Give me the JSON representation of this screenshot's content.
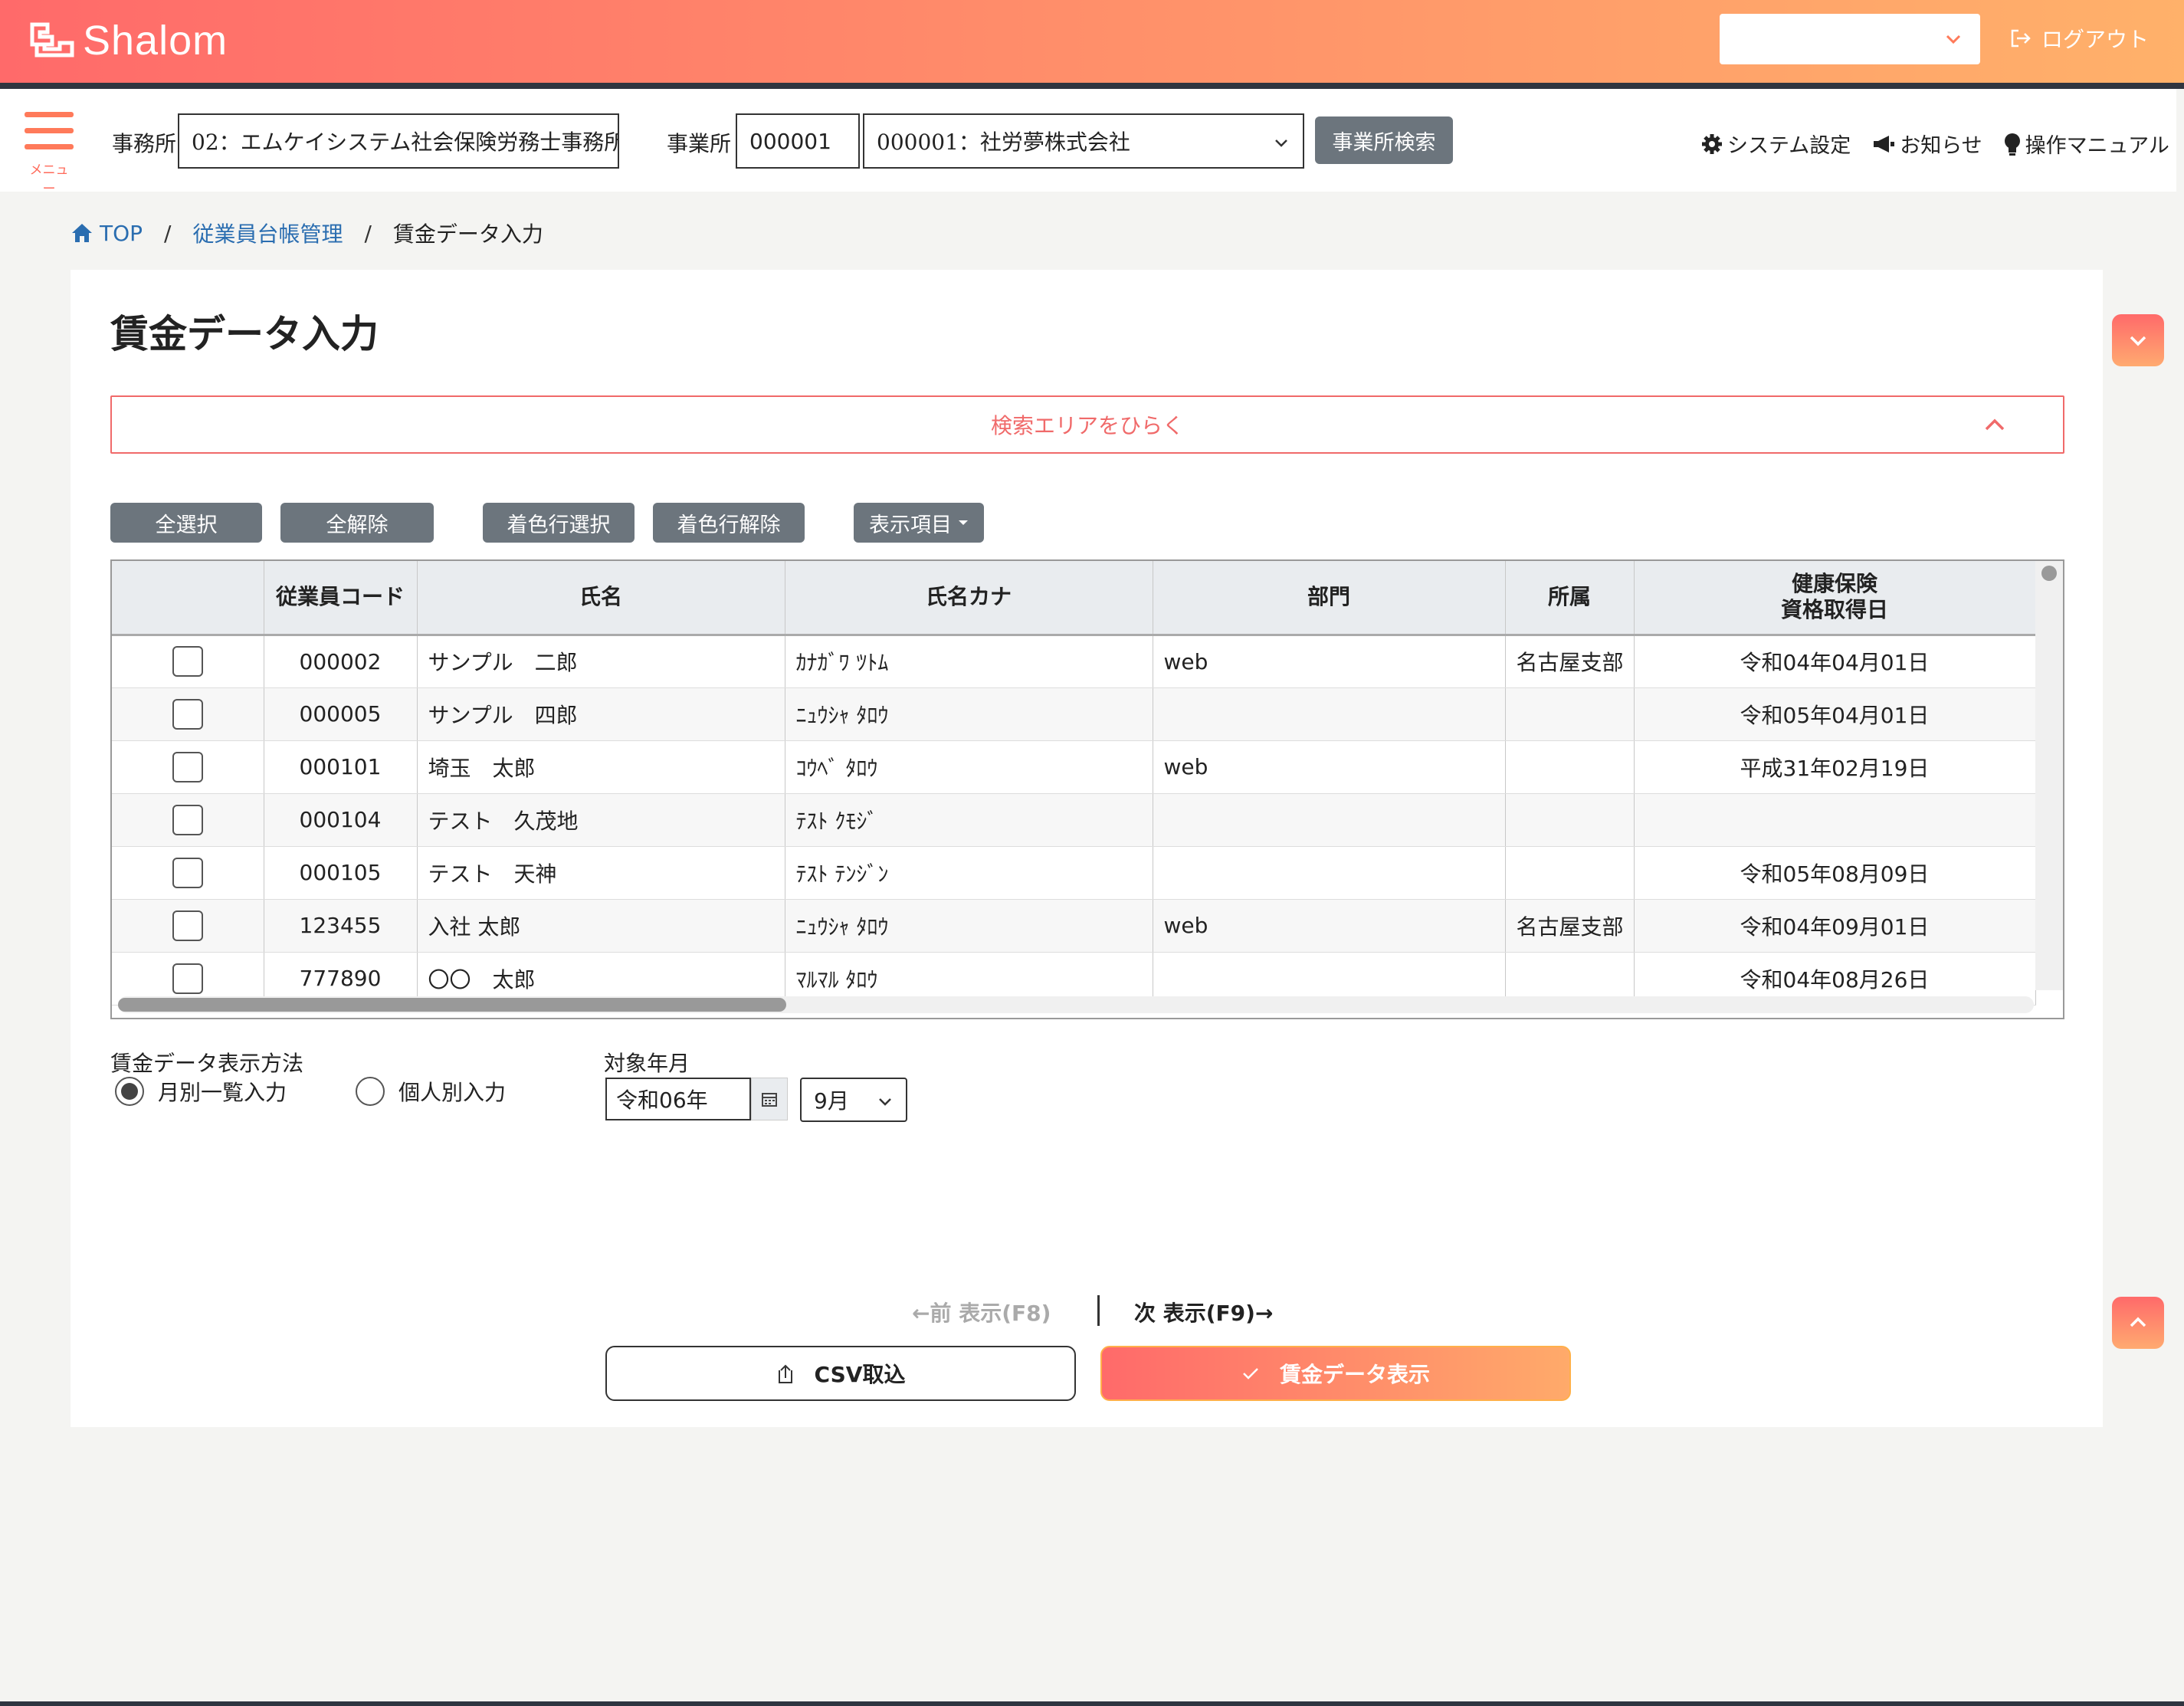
{
  "header": {
    "brand": "Shalom",
    "top_select_value": "",
    "logout_label": "ログアウト",
    "menu_label": "メニュー",
    "office_label": "事務所",
    "office_value": "02：エムケイシステム社会保険労務士事務所",
    "site_label": "事業所",
    "site_code": "000001",
    "site_name": "000001：社労夢株式会社",
    "site_search_button": "事業所検索",
    "links": {
      "system_settings": "システム設定",
      "notices": "お知らせ",
      "manual": "操作マニュアル"
    }
  },
  "breadcrumb": {
    "top": "TOP",
    "sep": "/",
    "level1": "従業員台帳管理",
    "current": "賃金データ入力"
  },
  "page": {
    "title": "賃金データ入力",
    "search_toggle": "検索エリアをひらく"
  },
  "toolbar": {
    "select_all": "全選択",
    "deselect_all": "全解除",
    "select_colored": "着色行選択",
    "deselect_colored": "着色行解除",
    "display_items": "表示項目"
  },
  "table": {
    "headers": [
      "",
      "従業員コード",
      "氏名",
      "氏名カナ",
      "部門",
      "所属",
      "健康保険\n資格取得日"
    ],
    "header_hi_1": "健康保険",
    "header_hi_2": "資格取得日",
    "rows": [
      {
        "code": "000002",
        "name": "サンプル　二郎",
        "kana": "ｶﾅｶﾞﾜ ﾂﾄﾑ",
        "dept": "web",
        "affiliation": "名古屋支部",
        "date": "令和04年04月01日"
      },
      {
        "code": "000005",
        "name": "サンプル　四郎",
        "kana": "ﾆｭｳｼｬ ﾀﾛｳ",
        "dept": "",
        "affiliation": "",
        "date": "令和05年04月01日"
      },
      {
        "code": "000101",
        "name": "埼玉　太郎",
        "kana": "ｺｳﾍﾞ ﾀﾛｳ",
        "dept": "web",
        "affiliation": "",
        "date": "平成31年02月19日"
      },
      {
        "code": "000104",
        "name": "テスト　久茂地",
        "kana": "ﾃｽﾄ ｸﾓｼﾞ",
        "dept": "",
        "affiliation": "",
        "date": ""
      },
      {
        "code": "000105",
        "name": "テスト　天神",
        "kana": "ﾃｽﾄ ﾃﾝｼﾞﾝ",
        "dept": "",
        "affiliation": "",
        "date": "令和05年08月09日"
      },
      {
        "code": "123455",
        "name": "入社 太郎",
        "kana": "ﾆｭｳｼｬ ﾀﾛｳ",
        "dept": "web",
        "affiliation": "名古屋支部",
        "date": "令和04年09月01日"
      },
      {
        "code": "777890",
        "name": "〇〇　太郎",
        "kana": "ﾏﾙﾏﾙ ﾀﾛｳ",
        "dept": "",
        "affiliation": "",
        "date": "令和04年08月26日"
      }
    ]
  },
  "form": {
    "method_label": "賃金データ表示方法",
    "option_monthly": "月別一覧入力",
    "option_individual": "個人別入力",
    "selected_option": "月別一覧入力",
    "target_label": "対象年月",
    "year_value": "令和06年",
    "month_value": "9月"
  },
  "pager": {
    "prev": "←前 表示(F8)",
    "next": "次 表示(F9)→"
  },
  "actions": {
    "csv_import": "CSV取込",
    "show_wage_data": "賃金データ表示"
  },
  "colors": {
    "accent_start": "#ff6a6a",
    "accent_end": "#ffb16a",
    "button_gray": "#6c757d",
    "link": "#2a6db0"
  }
}
